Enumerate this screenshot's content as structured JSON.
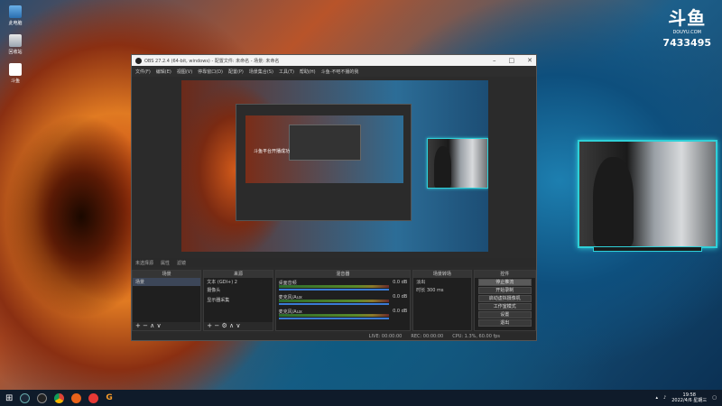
{
  "desktop": {
    "icons": [
      {
        "label": "此电脑"
      },
      {
        "label": "回收站"
      },
      {
        "label": "斗鱼"
      }
    ]
  },
  "douyu": {
    "logo": "斗鱼",
    "domain": "DOUYU.COM",
    "room": "7433495"
  },
  "obs": {
    "title": "OBS 27.2.4 (64-bit, windows) - 配置文件: 未命名 - 场景: 未命名",
    "menu": [
      "文件(F)",
      "编辑(E)",
      "视图(V)",
      "停靠窗口(D)",
      "配置(P)",
      "场景集合(S)",
      "工具(T)",
      "帮助(H)",
      "斗鱼-不吧不播的我"
    ],
    "preview_text": "斗鱼平台开播成功",
    "scene_bar": {
      "label": "未选择源",
      "props": "属性",
      "filters": "滤镜"
    },
    "docks": {
      "scenes": {
        "title": "场景",
        "items": [
          "场景"
        ],
        "footer": "+ − ∧ ∨"
      },
      "sources": {
        "title": "来源",
        "items": [
          "文本 (GDI+) 2",
          "摄像头",
          "",
          "显示器采集"
        ],
        "footer": "+ − ⚙ ∧ ∨"
      },
      "mixer": {
        "title": "混音器",
        "rows": [
          {
            "name": "桌面音频",
            "db": "0.0 dB"
          },
          {
            "name": "麦克风/Aux",
            "db": "0.0 dB"
          },
          {
            "name": "麦克风/Aux",
            "db": "0.0 dB"
          }
        ]
      },
      "transitions": {
        "title": "场景转场",
        "type": "淡出",
        "duration_label": "时长",
        "duration": "300 ms"
      },
      "controls": {
        "title": "控件",
        "buttons": [
          "停止推流",
          "开始录制",
          "启动虚拟摄像机",
          "工作室模式",
          "设置",
          "退出"
        ]
      }
    },
    "status": {
      "live": "LIVE: 00:00:00",
      "rec": "REC: 00:00:00",
      "cpu": "CPU: 1.3%, 60.00 fps"
    }
  },
  "taskbar": {
    "time": "19:58",
    "date": "2022/4/6 星期三"
  }
}
